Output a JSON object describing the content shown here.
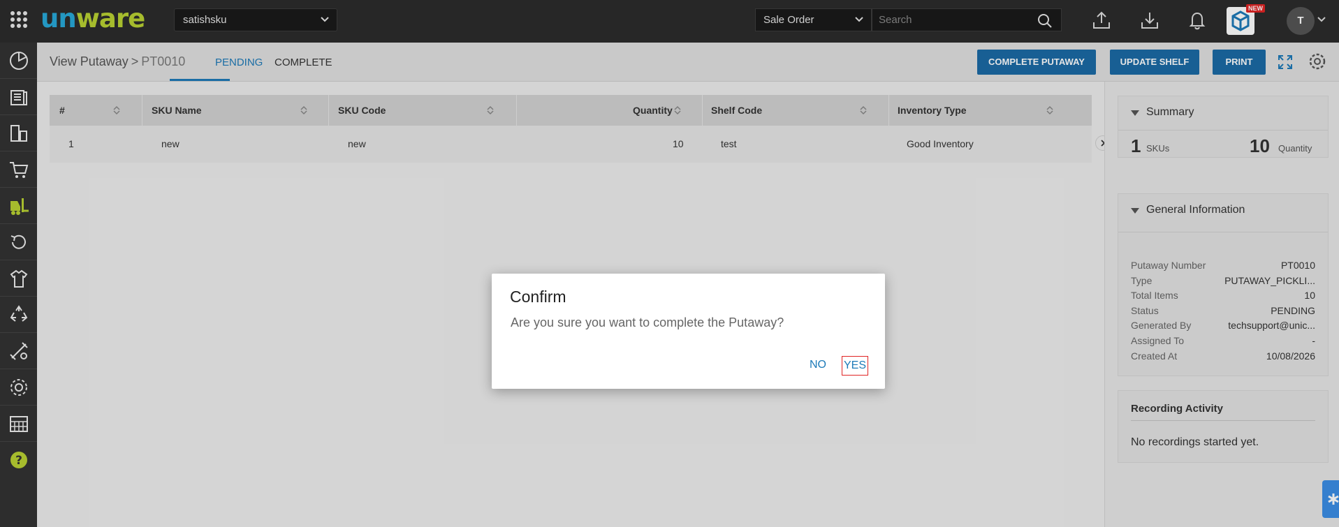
{
  "header": {
    "logo_part1": "un",
    "logo_part2": "ware",
    "tenant": "satishsku",
    "search_type": "Sale Order",
    "search_placeholder": "Search",
    "new_badge": "NEW",
    "avatar_initial": "T"
  },
  "sidebar": {
    "items": [
      "dashboard-icon",
      "orders-icon",
      "products-icon",
      "cart-icon",
      "forklift-icon",
      "returns-icon",
      "apparel-icon",
      "recycle-icon",
      "tools-icon",
      "settings-icon",
      "warehouse-icon",
      "help-icon"
    ],
    "active_index": 4
  },
  "page": {
    "breadcrumb_parent": "View Putaway",
    "breadcrumb_current": "PT0010",
    "tabs": [
      {
        "label": "PENDING",
        "active": true
      },
      {
        "label": "COMPLETE",
        "active": false
      }
    ],
    "buttons": {
      "complete": "COMPLETE PUTAWAY",
      "update_shelf": "UPDATE SHELF",
      "print": "PRINT"
    }
  },
  "table": {
    "columns": [
      "#",
      "SKU Name",
      "SKU Code",
      "Quantity",
      "Shelf Code",
      "Inventory Type"
    ],
    "rows": [
      [
        "1",
        "new",
        "new",
        "10",
        "test",
        "Good Inventory"
      ]
    ]
  },
  "summary": {
    "title": "Summary",
    "sku_count": "1",
    "sku_label": "SKUs",
    "quantity": "10",
    "quantity_label": "Quantity"
  },
  "general_info": {
    "title": "General Information",
    "fields": [
      {
        "label": "Putaway Number",
        "value": "PT0010"
      },
      {
        "label": "Type",
        "value": "PUTAWAY_PICKLI..."
      },
      {
        "label": "Total Items",
        "value": "10"
      },
      {
        "label": "Status",
        "value": "PENDING"
      },
      {
        "label": "Generated By",
        "value": "techsupport@unic..."
      },
      {
        "label": "Assigned To",
        "value": "-"
      },
      {
        "label": "Created At",
        "value": "10/08/2026"
      }
    ]
  },
  "recording": {
    "title": "Recording Activity",
    "message": "No recordings started yet."
  },
  "dialog": {
    "title": "Confirm",
    "message": "Are you sure you want to complete the Putaway?",
    "no_label": "NO",
    "yes_label": "YES"
  },
  "colors": {
    "primary": "#1b6aa5",
    "accent_blue": "#1d7ab8",
    "topbar": "#2c2c2c",
    "sidebar": "#333333",
    "highlight_border": "#e02424"
  }
}
